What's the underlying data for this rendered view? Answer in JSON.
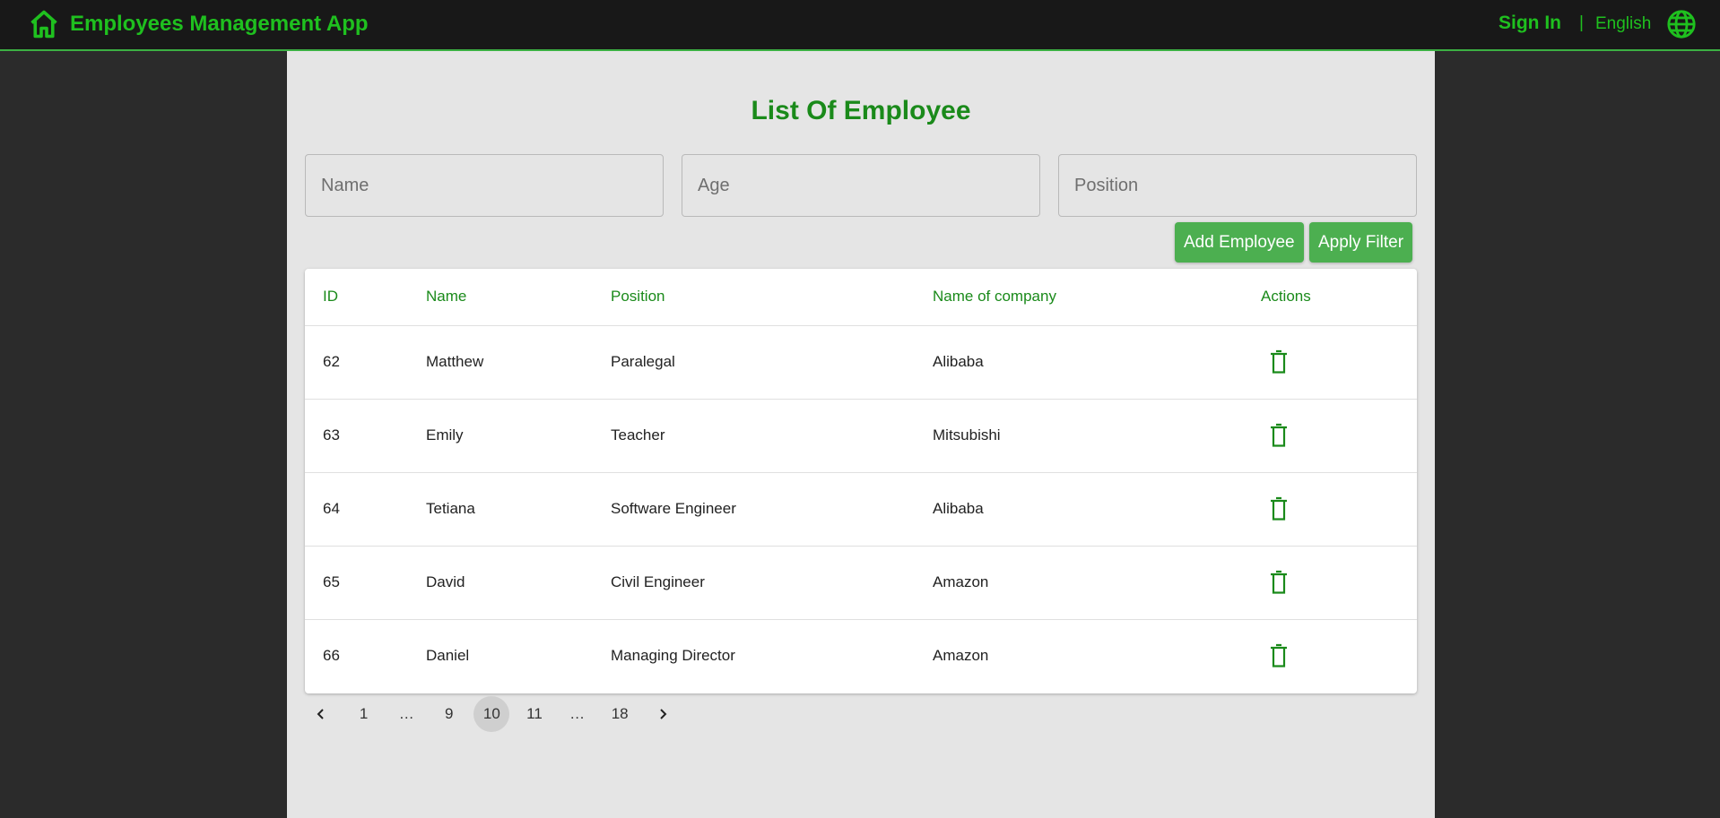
{
  "header": {
    "app_title": "Employees Management App",
    "sign_in": "Sign In",
    "separator": "|",
    "language": "English",
    "home_icon": "home-icon",
    "globe_icon": "globe-icon"
  },
  "main": {
    "title": "List Of Employee",
    "filters": {
      "name_placeholder": "Name",
      "age_placeholder": "Age",
      "position_placeholder": "Position",
      "name_value": "",
      "age_value": "",
      "position_value": ""
    },
    "buttons": {
      "add_employee": "Add Employee",
      "apply_filter": "Apply Filter"
    },
    "table": {
      "columns": [
        "ID",
        "Name",
        "Position",
        "Name of company",
        "Actions"
      ],
      "rows": [
        {
          "id": "62",
          "name": "Matthew",
          "position": "Paralegal",
          "company": "Alibaba",
          "action_icon": "trash-icon"
        },
        {
          "id": "63",
          "name": "Emily",
          "position": "Teacher",
          "company": "Mitsubishi",
          "action_icon": "trash-icon"
        },
        {
          "id": "64",
          "name": "Tetiana",
          "position": "Software Engineer",
          "company": "Alibaba",
          "action_icon": "trash-icon"
        },
        {
          "id": "65",
          "name": "David",
          "position": "Civil Engineer",
          "company": "Amazon",
          "action_icon": "trash-icon"
        },
        {
          "id": "66",
          "name": "Daniel",
          "position": "Managing Director",
          "company": "Amazon",
          "action_icon": "trash-icon"
        }
      ]
    },
    "pagination": {
      "items": [
        "1",
        "…",
        "9",
        "10",
        "11",
        "…",
        "18"
      ],
      "current": "10",
      "prev_icon": "chevron-left-icon",
      "next_icon": "chevron-right-icon"
    }
  },
  "colors": {
    "accent": "#1fc01f",
    "title": "#1a8a1a",
    "button": "#4caf50",
    "header_bg": "#181818",
    "panel_bg": "#e5e5e5",
    "page_bg": "#2b2b2b"
  }
}
